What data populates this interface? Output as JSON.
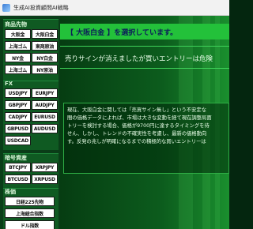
{
  "window": {
    "title": "生成AI投資顧問AI戦略"
  },
  "sidebar": {
    "sections": [
      {
        "title": "商品先物",
        "buttons": [
          "大阪金",
          "大阪白金",
          "上海ゴム",
          "東商原油",
          "NY金",
          "NY白金",
          "上海ゴム",
          "NY原油"
        ]
      },
      {
        "title": "FX",
        "buttons": [
          "USDJPY",
          "EURJPY",
          "GBPJPY",
          "AUDJPY",
          "CADJPY",
          "EURUSD",
          "GBPUSD",
          "AUDUSD",
          "USDCAD"
        ]
      },
      {
        "title": "暗号資産",
        "buttons": [
          "BTCJPY",
          "XRPJPY",
          "BTCUSD",
          "XRPUSD"
        ]
      },
      {
        "title": "株価",
        "buttons": [
          "日経225先物",
          "上海総合指数",
          "ドル指数"
        ]
      }
    ]
  },
  "main": {
    "banner": "【 大阪白金 】を選択しています。",
    "notice": "売りサインが消えましたが買いエントリーは危険",
    "detail_lines": [
      "現在、大阪白金に関しては「売買サイン無し」という不安定な",
      "間の価格データによれば、市場は大きな変動を経て現在調整局面",
      "トリーを検討する場合、価格が9700円に達するタイミングを待",
      "せん、しかし、トレンドの不確実性を考慮し、最新の価格動向",
      "す。反発の兆しが明確になるまでの積極的な買いエントリーは"
    ]
  },
  "colors": {
    "banner_bg": "#23c13a",
    "banner_text": "#0b1a5a",
    "sidebar_bg": "#0a3d18"
  }
}
